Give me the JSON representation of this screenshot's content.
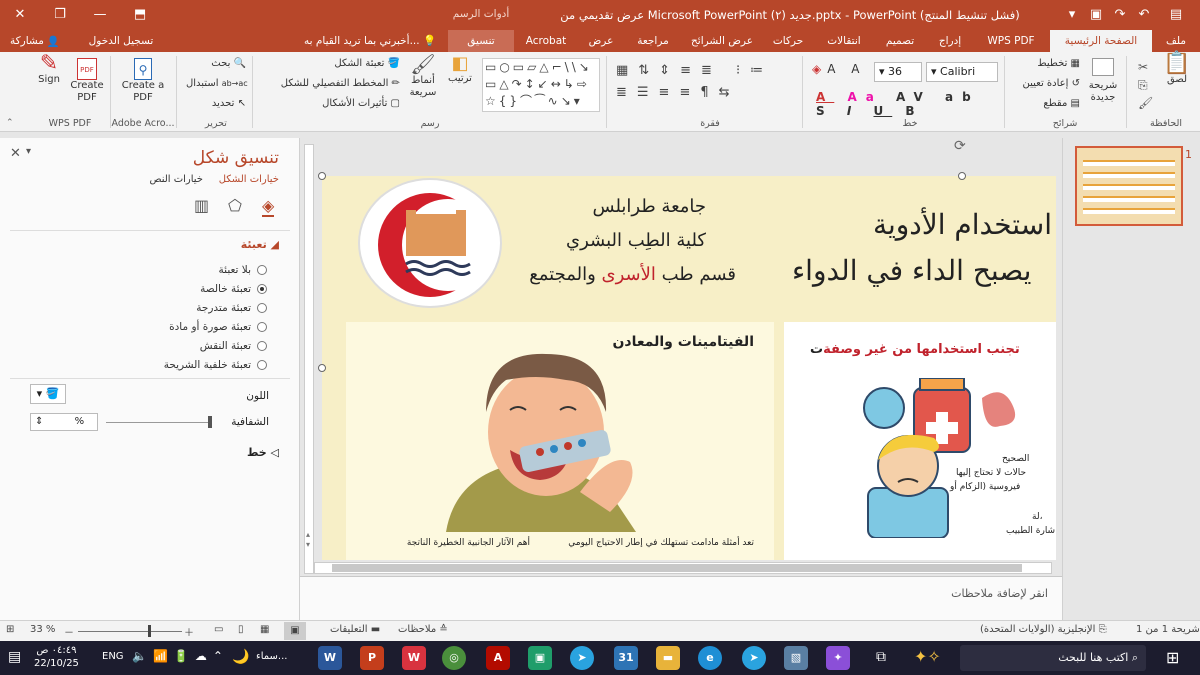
{
  "titlebar": {
    "title": "عرض تقديمي من Microsoft PowerPoint جديد (٢).pptx - PowerPoint (فشل تنشيط المنتج)",
    "context_group": "أدوات الرسم",
    "restore_icon": "restore-icon",
    "minimize_icon": "minimize-icon",
    "close_icon": "close-icon"
  },
  "tabs": {
    "file": "ملف",
    "home": "الصفحة الرئيسية",
    "wps_pdf": "WPS PDF",
    "insert": "إدراج",
    "design": "تصميم",
    "transitions": "انتقالات",
    "animations": "حركات",
    "slideshow": "عرض الشرائح",
    "review": "مراجعة",
    "view": "عرض",
    "acrobat": "Acrobat",
    "format": "تنسيق",
    "tell_me": "أخبرني بما تريد القيام به...",
    "sign_in": "تسجيل الدخول",
    "share": "مشاركة"
  },
  "ribbon": {
    "clipboard": {
      "paste": "لصق",
      "label": "الحافظة"
    },
    "slides": {
      "new_slide": "شريحة جديدة",
      "layout": "تخطيط",
      "reset": "إعادة تعيين",
      "section": "مقطع",
      "label": "شرائح"
    },
    "font": {
      "font_name": "Calibri",
      "font_size": "36",
      "label": "خط"
    },
    "paragraph": {
      "label": "فقرة"
    },
    "drawing": {
      "arrange": "ترتيب",
      "quick_styles": "أنماط سريعة",
      "shape_fill": "تعبئة الشكل",
      "shape_outline": "المخطط التفصيلي للشكل",
      "shape_effects": "تأثيرات الأشكال",
      "label": "رسم"
    },
    "editing": {
      "find": "بحث",
      "replace": "استبدال",
      "select": "تحديد",
      "label": "تحرير"
    },
    "adobe": {
      "create_pdf": "Create a PDF",
      "label": "Adobe Acro..."
    },
    "wps": {
      "sign": "Sign",
      "create_pdf": "Create PDF",
      "label": "WPS PDF"
    }
  },
  "pane": {
    "title": "تنسيق شكل",
    "tab_shape": "خيارات الشكل",
    "tab_text": "خيارات النص",
    "fill_section": "تعبئة",
    "fill_options": [
      {
        "label": "بلا تعبئة",
        "selected": false
      },
      {
        "label": "تعبئة خالصة",
        "selected": true
      },
      {
        "label": "تعبئة متدرجة",
        "selected": false
      },
      {
        "label": "تعبئة صورة أو مادة",
        "selected": false
      },
      {
        "label": "تعبئة النقش",
        "selected": false
      },
      {
        "label": "تعبئة خلفية الشريحة",
        "selected": false
      }
    ],
    "color_label": "اللون",
    "transparency_label": "الشفافية",
    "transparency_value": "%",
    "line_section": "خط"
  },
  "slide": {
    "univ_line1": "جامعة طرابلس",
    "univ_line2": "كلية الطِب البشري",
    "univ_line3a": "قسم طب ",
    "univ_line3b": "الأسرى",
    "univ_line3c": " والمجتمع",
    "headline1": "استخدام الأدوية",
    "headline2": "يصبح الداء في الدواء",
    "card_left_title": "الفيتامينات والمعادن",
    "card_left_body_a": "تعد أمثلة مادامت تستهلك في إطار الاحتياج اليومي",
    "card_left_body_b": "أهم الآثار الجانبية الخطيرة الناتجة",
    "card_right_title_a": "ت ",
    "card_right_title_b": "تجنب استخدامها من غير وصفة",
    "card_right_body1": "الصحيح",
    "card_right_body2": "حالات لا تحتاج إليها",
    "card_right_body3": "فيروسية (الزكام أو",
    "card_right_body4": "لة،",
    "card_right_body5": "شارة الطبيب"
  },
  "thumbs": {
    "number": "1"
  },
  "notes": {
    "placeholder": "انقر لإضافة ملاحظات"
  },
  "status": {
    "slide_of": "شريحة 1 من 1",
    "language": "الإنجليزية (الولايات المتحدة)",
    "notes": "ملاحظات",
    "comments": "التعليقات",
    "zoom": "33 %"
  },
  "taskbar": {
    "search": "اكتب هنا للبحث",
    "time": "٠٤:٤٩ ص",
    "date": "22/10/25",
    "lang": "ENG",
    "weather": "سماء..."
  },
  "colors": {
    "accent": "#b7472a",
    "slide_bg": "#f7efc7",
    "crescent": "#d21f2b"
  }
}
